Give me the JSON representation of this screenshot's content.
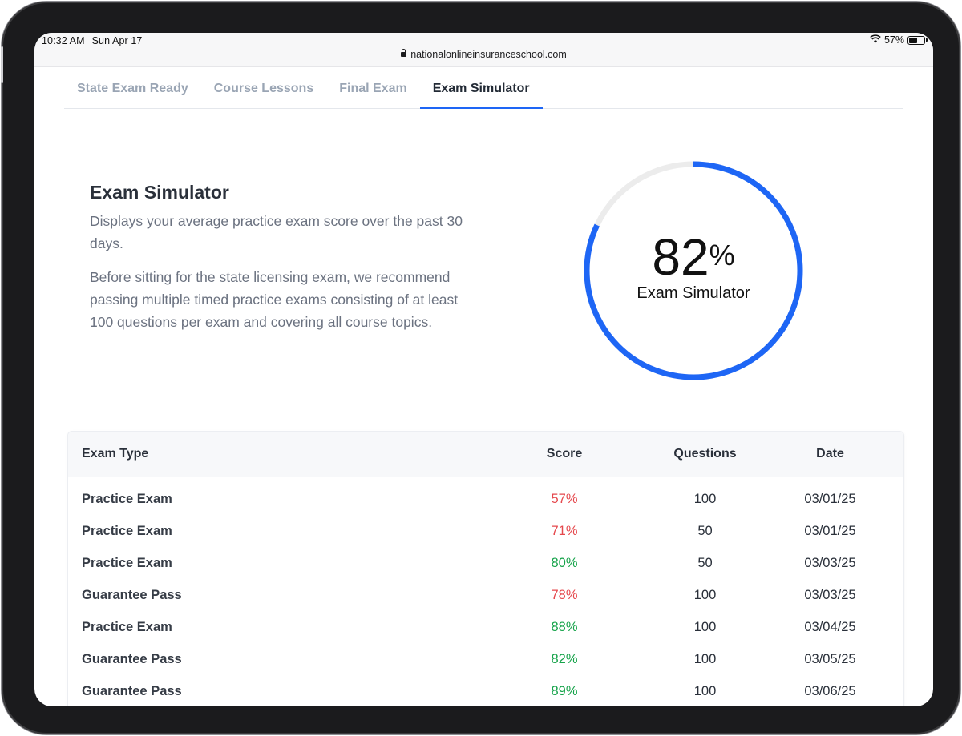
{
  "status_bar": {
    "time": "10:32 AM",
    "date": "Sun Apr 17",
    "battery": "57%",
    "battery_level": 0.57,
    "wifi_icon": "wifi-icon",
    "battery_icon": "battery-icon"
  },
  "browser": {
    "url": "nationalonlineinsuranceschool.com",
    "lock_icon": "lock-icon"
  },
  "tabs": [
    {
      "label": "State Exam Ready",
      "active": false
    },
    {
      "label": "Course Lessons",
      "active": false
    },
    {
      "label": "Final Exam",
      "active": false
    },
    {
      "label": "Exam Simulator",
      "active": true
    }
  ],
  "info": {
    "title": "Exam Simulator",
    "description": "Displays your average practice exam score over the past 30 days.",
    "recommendation": "Before sitting for the state licensing exam, we recommend passing multiple timed practice exams consisting of at least 100 questions per exam and covering all course topics."
  },
  "progress": {
    "value": "82",
    "percent_sign": "%",
    "fraction": 0.82,
    "label": "Exam Simulator",
    "colors": {
      "fill": "#1e66f5",
      "track": "#ececec"
    }
  },
  "table": {
    "headers": {
      "exam_type": "Exam Type",
      "score": "Score",
      "questions": "Questions",
      "date": "Date"
    },
    "rows": [
      {
        "exam_type": "Practice Exam",
        "score": "57%",
        "status": "fail",
        "questions": "100",
        "date": "03/01/25"
      },
      {
        "exam_type": "Practice Exam",
        "score": "71%",
        "status": "fail",
        "questions": "50",
        "date": "03/01/25"
      },
      {
        "exam_type": "Practice Exam",
        "score": "80%",
        "status": "pass",
        "questions": "50",
        "date": "03/03/25"
      },
      {
        "exam_type": "Guarantee Pass",
        "score": "78%",
        "status": "fail",
        "questions": "100",
        "date": "03/03/25"
      },
      {
        "exam_type": "Practice Exam",
        "score": "88%",
        "status": "pass",
        "questions": "100",
        "date": "03/04/25"
      },
      {
        "exam_type": "Guarantee Pass",
        "score": "82%",
        "status": "pass",
        "questions": "100",
        "date": "03/05/25"
      },
      {
        "exam_type": "Guarantee Pass",
        "score": "89%",
        "status": "pass",
        "questions": "100",
        "date": "03/06/25"
      }
    ],
    "colors": {
      "fail": "#e5484d",
      "pass": "#16a34a"
    }
  }
}
